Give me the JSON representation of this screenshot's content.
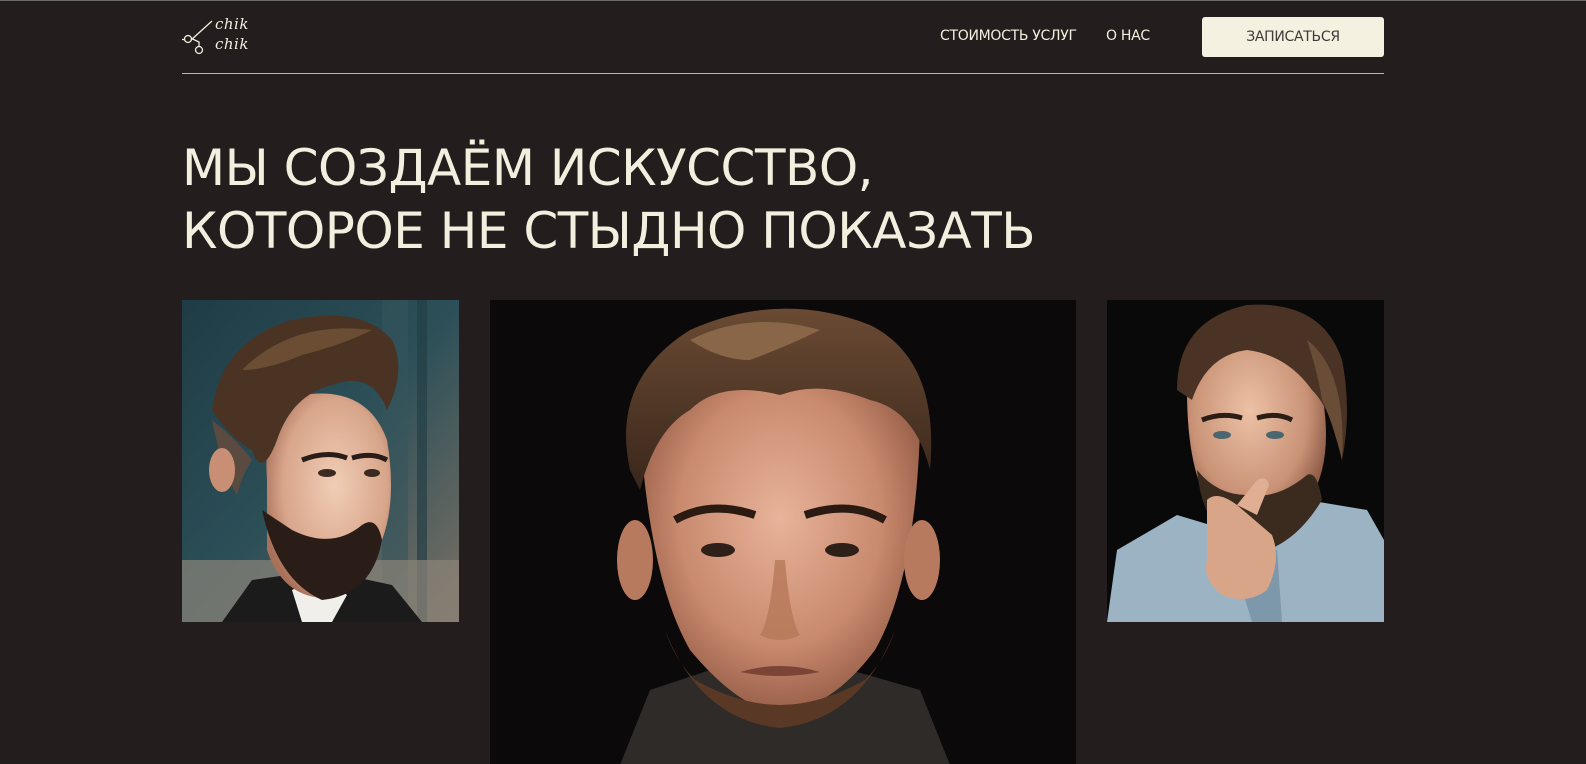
{
  "logo": {
    "line1": "chik",
    "line2": "chik",
    "icon": "scissors-icon"
  },
  "nav": [
    {
      "label": "СТОИМОСТЬ УСЛУГ"
    },
    {
      "label": "О НАС"
    }
  ],
  "cta_label": "ЗАПИСАТЬСЯ",
  "hero": {
    "line1": "МЫ СОЗДАЁМ ИСКУССТВО,",
    "line2": "КОТОРОЕ НЕ СТЫДНО ПОКАЗАТЬ"
  },
  "photos": [
    {
      "name": "man-with-pompadour-and-beard-photo"
    },
    {
      "name": "man-with-wavy-hair-portrait-photo"
    },
    {
      "name": "bearded-man-hand-on-chin-photo"
    }
  ],
  "colors": {
    "background": "#241d1d",
    "text": "#f3efdf",
    "button_bg": "#f4f1e1",
    "button_text": "#3f3a38"
  }
}
